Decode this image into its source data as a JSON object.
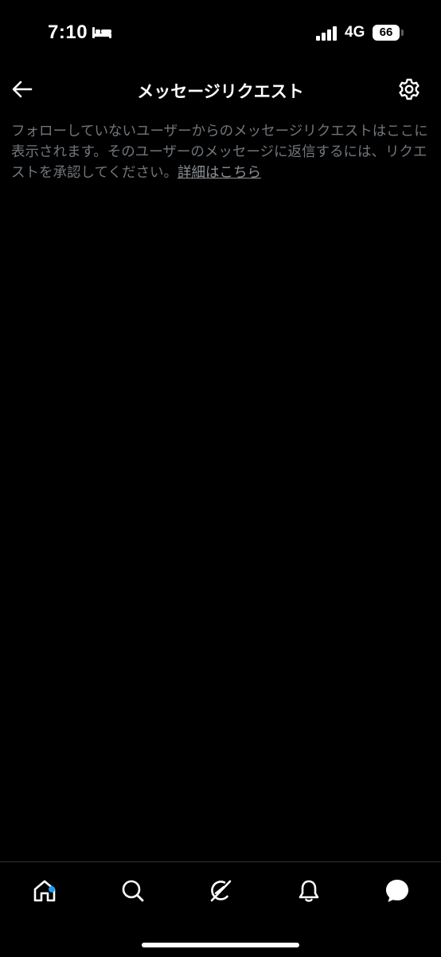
{
  "status_bar": {
    "time": "7:10",
    "network": "4G",
    "battery": "66",
    "icons": [
      "sleep-focus-icon",
      "signal-bars-icon"
    ]
  },
  "header": {
    "title": "メッセージリクエスト",
    "back_icon": "arrow-left-icon",
    "settings_icon": "gear-icon"
  },
  "description": {
    "text": "フォローしていないユーザーからのメッセージリクエストはここに表示されます。そのユーザーのメッセージに返信するには、リクエストを承認してください。",
    "link_text": "詳細はこちら"
  },
  "bottom_nav": {
    "items": [
      {
        "icon": "home-icon",
        "has_notification_dot": true
      },
      {
        "icon": "search-icon",
        "has_notification_dot": false
      },
      {
        "icon": "grok-icon",
        "has_notification_dot": false
      },
      {
        "icon": "bell-icon",
        "has_notification_dot": false
      },
      {
        "icon": "messages-icon",
        "has_notification_dot": false
      }
    ]
  },
  "colors": {
    "background": "#000000",
    "text_primary": "#ffffff",
    "text_secondary": "#71767b",
    "accent": "#1d9bf0",
    "divider": "#2f3336"
  }
}
